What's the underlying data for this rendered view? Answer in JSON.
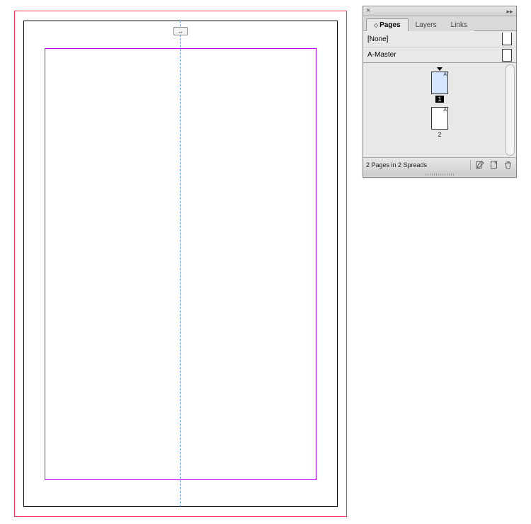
{
  "canvas": {
    "guide_icon": "text-split"
  },
  "panel": {
    "tabs": [
      {
        "label": "Pages",
        "active": true
      },
      {
        "label": "Layers",
        "active": false
      },
      {
        "label": "Links",
        "active": false
      }
    ],
    "masters": [
      {
        "name": "[None]"
      },
      {
        "name": "A-Master"
      }
    ],
    "pages": [
      {
        "number": "1",
        "master": "A",
        "selected": true,
        "current": true
      },
      {
        "number": "2",
        "master": "A",
        "selected": false,
        "current": false
      }
    ],
    "footer_status": "2 Pages in 2 Spreads"
  }
}
